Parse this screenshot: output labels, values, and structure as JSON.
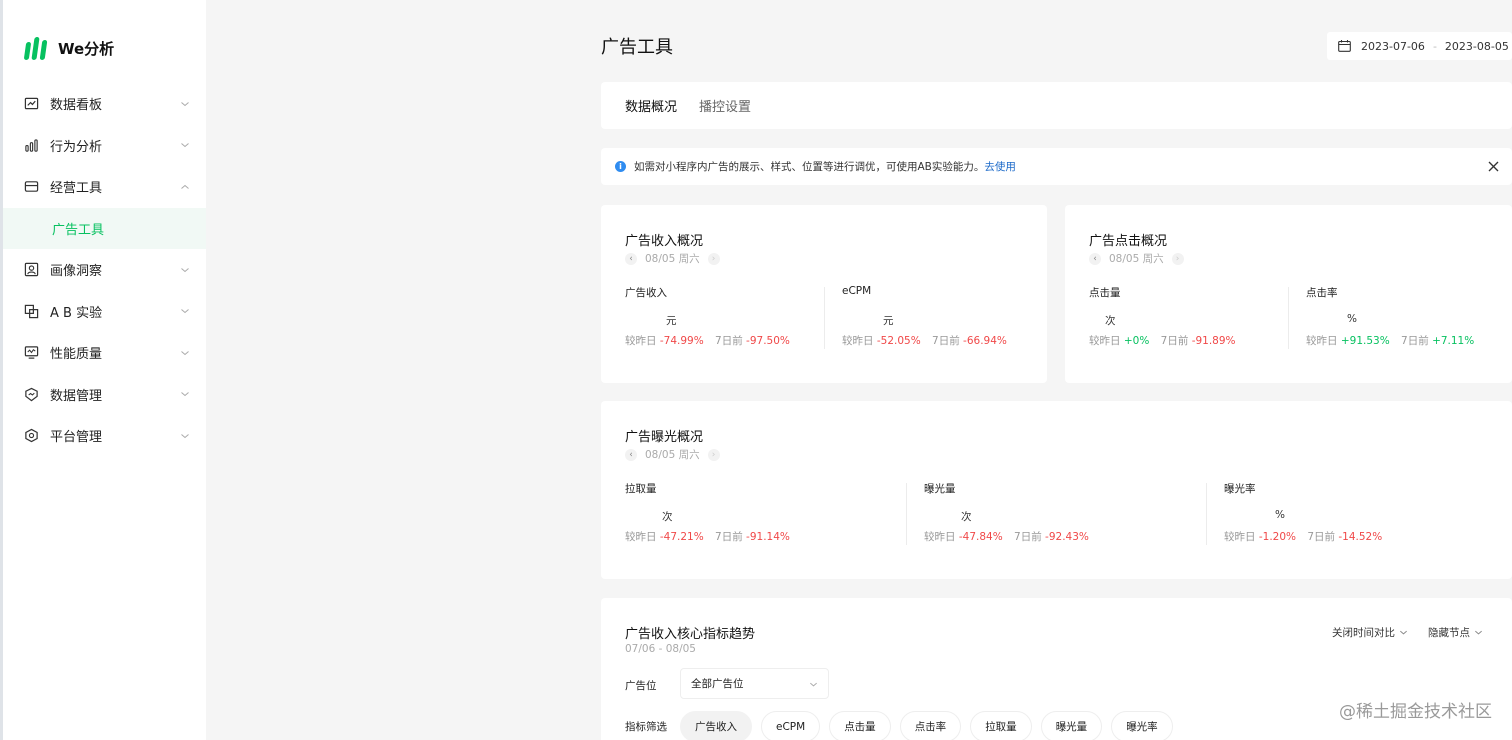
{
  "app": {
    "name": "We分析"
  },
  "sidebar": {
    "items": [
      {
        "label": "数据看板",
        "icon": "chart-line-icon",
        "expanded": false
      },
      {
        "label": "行为分析",
        "icon": "bar-chart-icon",
        "expanded": false
      },
      {
        "label": "经营工具",
        "icon": "storefront-icon",
        "expanded": true
      },
      {
        "label": "画像洞察",
        "icon": "portrait-icon",
        "expanded": false
      },
      {
        "label": "A B 实验",
        "icon": "ab-test-icon",
        "expanded": false
      },
      {
        "label": "性能质量",
        "icon": "monitor-icon",
        "expanded": false
      },
      {
        "label": "数据管理",
        "icon": "shield-icon",
        "expanded": false
      },
      {
        "label": "平台管理",
        "icon": "settings-hex-icon",
        "expanded": false
      }
    ],
    "active_sub_item": "广告工具"
  },
  "header": {
    "title": "广告工具",
    "date_start": "2023-07-06",
    "date_sep": "-",
    "date_end": "2023-08-05"
  },
  "tabs": [
    {
      "label": "数据概况",
      "active": true
    },
    {
      "label": "播控设置",
      "active": false
    }
  ],
  "notice": {
    "text": "如需对小程序内广告的展示、样式、位置等进行调优，可使用AB实验能力。",
    "link": "去使用"
  },
  "revenue_overview": {
    "title": "广告收入概况",
    "date": "08/05 周六",
    "metrics": [
      {
        "label": "广告收入",
        "unit": "元",
        "day_label": "较昨日",
        "day_value": "-74.99%",
        "day_trend": "down",
        "week_label": "7日前",
        "week_value": "-97.50%",
        "week_trend": "down"
      },
      {
        "label": "eCPM",
        "unit": "元",
        "day_label": "较昨日",
        "day_value": "-52.05%",
        "day_trend": "down",
        "week_label": "7日前",
        "week_value": "-66.94%",
        "week_trend": "down"
      }
    ]
  },
  "click_overview": {
    "title": "广告点击概况",
    "date": "08/05 周六",
    "metrics": [
      {
        "label": "点击量",
        "unit": "次",
        "day_label": "较昨日",
        "day_value": "+0%",
        "day_trend": "up",
        "week_label": "7日前",
        "week_value": "-91.89%",
        "week_trend": "down"
      },
      {
        "label": "点击率",
        "unit": "%",
        "day_label": "较昨日",
        "day_value": "+91.53%",
        "day_trend": "up",
        "week_label": "7日前",
        "week_value": "+7.11%",
        "week_trend": "up"
      }
    ]
  },
  "exposure_overview": {
    "title": "广告曝光概况",
    "date": "08/05 周六",
    "metrics": [
      {
        "label": "拉取量",
        "unit": "次",
        "day_label": "较昨日",
        "day_value": "-47.21%",
        "day_trend": "down",
        "week_label": "7日前",
        "week_value": "-91.14%",
        "week_trend": "down"
      },
      {
        "label": "曝光量",
        "unit": "次",
        "day_label": "较昨日",
        "day_value": "-47.84%",
        "day_trend": "down",
        "week_label": "7日前",
        "week_value": "-92.43%",
        "week_trend": "down"
      },
      {
        "label": "曝光率",
        "unit": "%",
        "day_label": "较昨日",
        "day_value": "-1.20%",
        "day_trend": "down",
        "week_label": "7日前",
        "week_value": "-14.52%",
        "week_trend": "down"
      }
    ]
  },
  "trend": {
    "title": "广告收入核心指标趋势",
    "range": "07/06 - 08/05",
    "compare_btn": "关闭时间对比",
    "nodes_btn": "隐藏节点",
    "slot_label": "广告位",
    "slot_value": "全部广告位",
    "filter_label": "指标筛选",
    "filters": [
      {
        "label": "广告收入",
        "active": true
      },
      {
        "label": "eCPM",
        "active": false
      },
      {
        "label": "点击量",
        "active": false
      },
      {
        "label": "点击率",
        "active": false
      },
      {
        "label": "拉取量",
        "active": false
      },
      {
        "label": "曝光量",
        "active": false
      },
      {
        "label": "曝光率",
        "active": false
      }
    ]
  },
  "watermark": "@稀土掘金技术社区",
  "colors": {
    "accent": "#07c160",
    "negative": "#f04848",
    "positive": "#07c160",
    "link": "#1c6ac9"
  }
}
